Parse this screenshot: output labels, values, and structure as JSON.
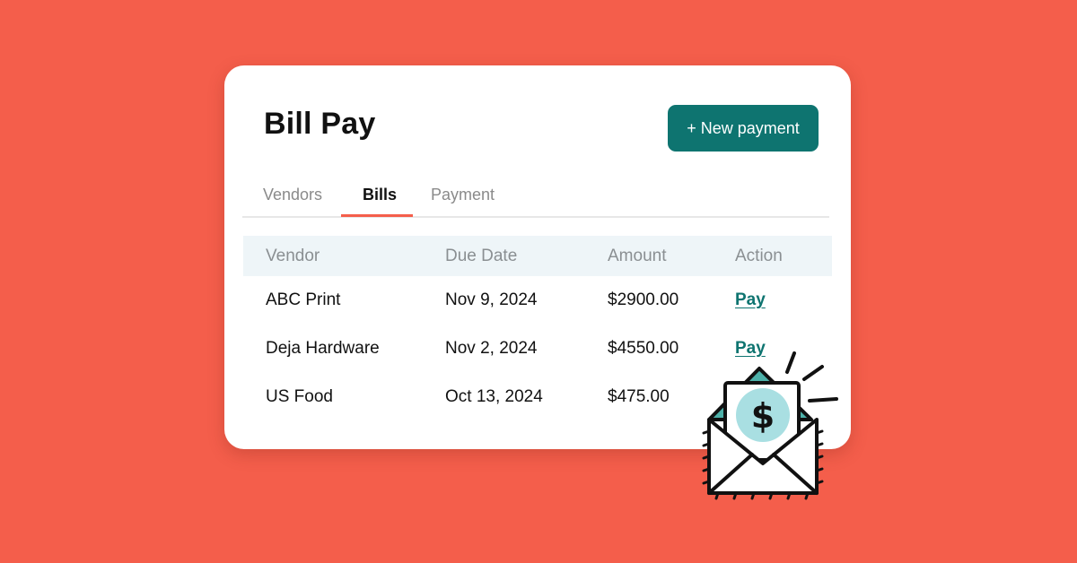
{
  "header": {
    "title": "Bill Pay",
    "new_payment_label": "+ New payment"
  },
  "tabs": [
    {
      "label": "Vendors",
      "active": false
    },
    {
      "label": "Bills",
      "active": true
    },
    {
      "label": "Payment",
      "active": false
    }
  ],
  "table": {
    "columns": [
      "Vendor",
      "Due Date",
      "Amount",
      "Action"
    ],
    "rows": [
      {
        "vendor": "ABC Print",
        "due_date": "Nov 9, 2024",
        "amount": "$2900.00",
        "action": "Pay"
      },
      {
        "vendor": "Deja Hardware",
        "due_date": "Nov 2, 2024",
        "amount": "$4550.00",
        "action": "Pay"
      },
      {
        "vendor": "US Food",
        "due_date": "Oct 13, 2024",
        "amount": "$475.00",
        "action": ""
      }
    ]
  },
  "illustration": {
    "name": "money-envelope-icon",
    "symbol": "$"
  },
  "colors": {
    "background": "#F45E4B",
    "accent": "#0E7470",
    "table_header_bg": "#EEF5F8",
    "active_tab_underline": "#F45E4B"
  }
}
